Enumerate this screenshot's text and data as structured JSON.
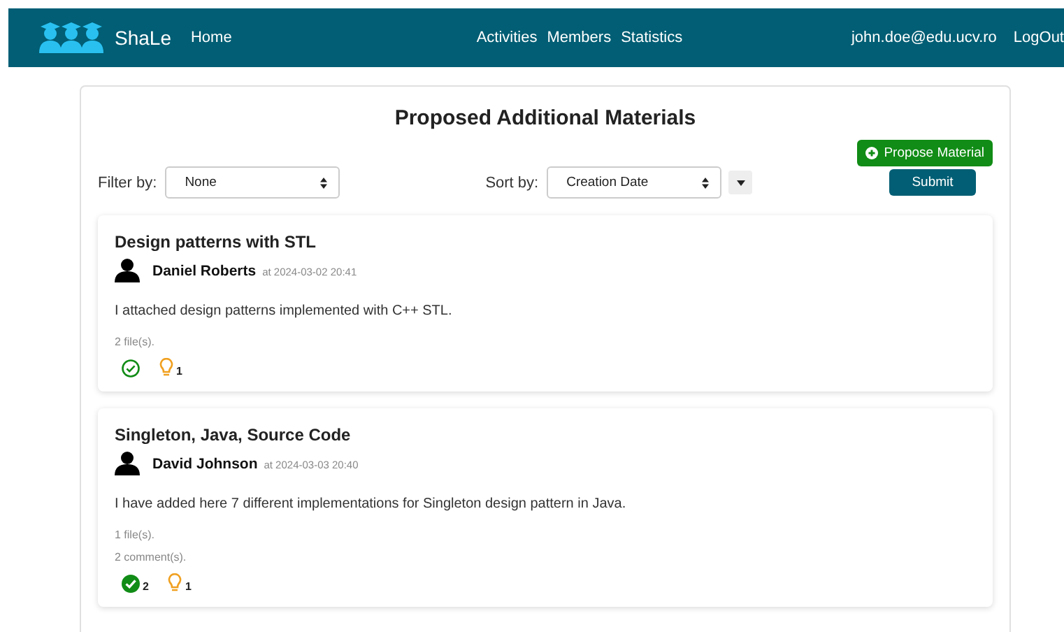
{
  "navbar": {
    "brand": "ShaLe",
    "left_links": [
      "Home"
    ],
    "center_links": [
      "Activities",
      "Members",
      "Statistics"
    ],
    "user": "john.doe@edu.ucv.ro",
    "logout": "LogOut"
  },
  "page": {
    "title": "Proposed Additional Materials",
    "propose_button": "Propose Material",
    "filter": {
      "label": "Filter by:",
      "value": "None"
    },
    "sort": {
      "label": "Sort by:",
      "value": "Creation Date"
    },
    "submit_button": "Submit"
  },
  "posts": [
    {
      "title": "Design patterns with STL",
      "author": "Daniel Roberts",
      "time": "at 2024-03-02 20:41",
      "body": "I attached design patterns implemented with C++ STL.",
      "meta": [
        "2 file(s)."
      ],
      "approved": false,
      "ideas": "1"
    },
    {
      "title": "Singleton, Java, Source Code",
      "author": "David Johnson",
      "time": "at 2024-03-03 20:40",
      "body": "I have added here 7 different implementations for Singleton design pattern in Java.",
      "meta": [
        "1 file(s).",
        "2 comment(s)."
      ],
      "approved": true,
      "approvals": "2",
      "ideas": "1"
    }
  ]
}
